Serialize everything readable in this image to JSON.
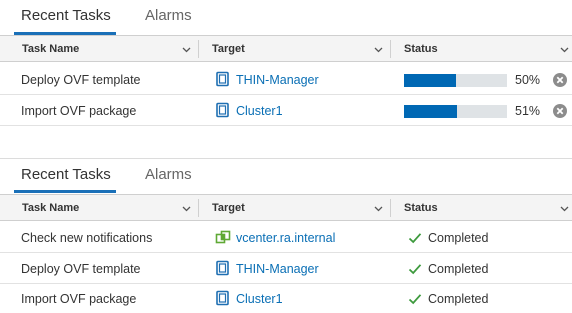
{
  "panels": [
    {
      "tabs": [
        {
          "label": "Recent Tasks",
          "active": true
        },
        {
          "label": "Alarms",
          "active": false
        }
      ],
      "columns": [
        "Task Name",
        "Target",
        "Status"
      ],
      "rows": [
        {
          "name": "Deploy OVF template",
          "target": "THIN-Manager",
          "target_icon": "vm-icon",
          "progress": 50,
          "status": "50%"
        },
        {
          "name": "Import OVF package",
          "target": "Cluster1",
          "target_icon": "vm-icon",
          "progress": 51,
          "status": "51%"
        }
      ]
    },
    {
      "tabs": [
        {
          "label": "Recent Tasks",
          "active": true
        },
        {
          "label": "Alarms",
          "active": false
        }
      ],
      "columns": [
        "Task Name",
        "Target",
        "Status"
      ],
      "rows": [
        {
          "name": "Check new notifications",
          "target": "vcenter.ra.internal",
          "target_icon": "vcenter-icon",
          "status": "Completed"
        },
        {
          "name": "Deploy OVF template",
          "target": "THIN-Manager",
          "target_icon": "vm-icon",
          "status": "Completed"
        },
        {
          "name": "Import OVF package",
          "target": "Cluster1",
          "target_icon": "vm-icon",
          "status": "Completed"
        }
      ]
    }
  ],
  "colors": {
    "accent": "#1a70b8",
    "progress_fill": "#0068b4",
    "link": "#0a6fb5",
    "success": "#3d9a3d",
    "vcenter_icon": "#5fa935"
  }
}
